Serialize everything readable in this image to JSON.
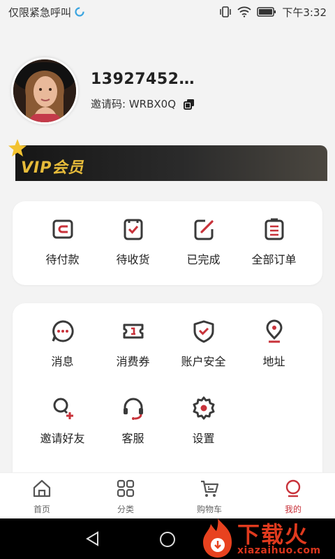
{
  "status_bar": {
    "carrier": "仅限紧急呼叫",
    "time": "下午3:32"
  },
  "profile": {
    "phone": "13927452…",
    "invite_label": "邀请码:",
    "invite_code": "WRBX0Q"
  },
  "vip": {
    "label": "VIP会员"
  },
  "orders": [
    {
      "label": "待付款",
      "icon": "wallet-icon"
    },
    {
      "label": "待收货",
      "icon": "receive-icon"
    },
    {
      "label": "已完成",
      "icon": "completed-icon"
    },
    {
      "label": "全部订单",
      "icon": "orders-icon"
    }
  ],
  "services": [
    {
      "label": "消息",
      "icon": "message-icon"
    },
    {
      "label": "消费券",
      "icon": "coupon-icon"
    },
    {
      "label": "账户安全",
      "icon": "shield-icon"
    },
    {
      "label": "地址",
      "icon": "location-icon"
    },
    {
      "label": "邀请好友",
      "icon": "invite-friend-icon"
    },
    {
      "label": "客服",
      "icon": "headset-icon"
    },
    {
      "label": "设置",
      "icon": "settings-icon"
    }
  ],
  "tabs": [
    {
      "label": "首页",
      "icon": "home-icon"
    },
    {
      "label": "分类",
      "icon": "category-icon"
    },
    {
      "label": "购物车",
      "icon": "cart-icon"
    },
    {
      "label": "我的",
      "icon": "profile-icon"
    }
  ],
  "watermark": {
    "title": "下载火",
    "url": "xiazaihuo.com"
  },
  "colors": {
    "accent": "#c8323a",
    "gold": "#e6bb3a",
    "icon_dark": "#3a3a3a"
  }
}
